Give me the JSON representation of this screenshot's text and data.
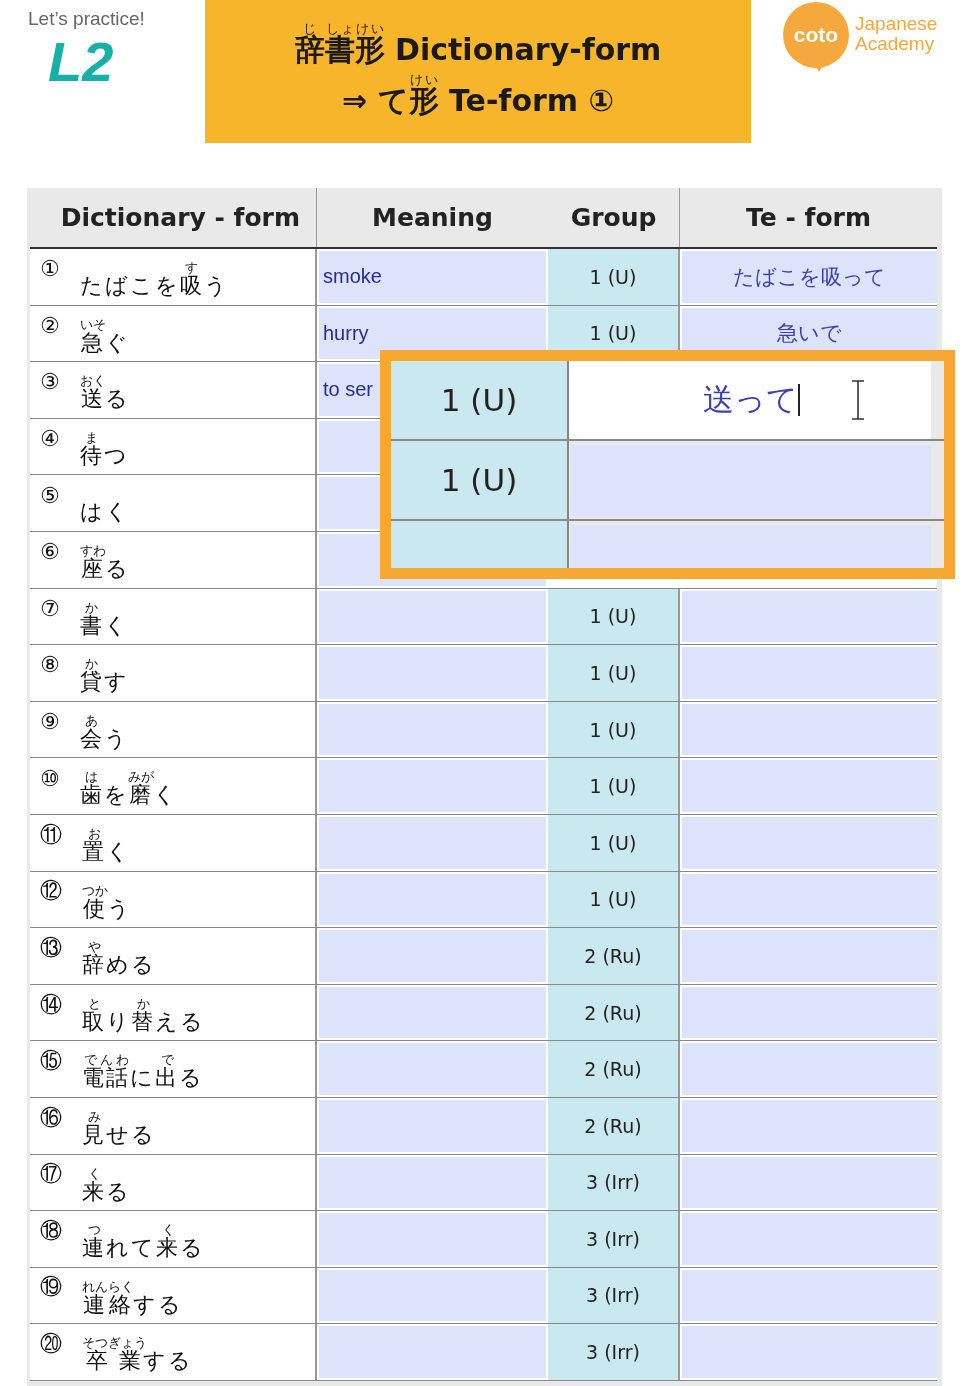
{
  "header": {
    "subtitle": "Let’s practice!",
    "level": "L2",
    "title_lines": [
      [
        {
          "text": "辞",
          "ruby": "じ"
        },
        {
          "text": "書",
          "ruby": "しょ"
        },
        {
          "text": "形",
          "ruby": "けい"
        },
        {
          "text": " Dictionary-form"
        }
      ],
      [
        {
          "text": "⇒ て"
        },
        {
          "text": "形",
          "ruby": "けい"
        },
        {
          "text": " Te-form ①"
        }
      ]
    ],
    "logo": {
      "badge": "coto",
      "name_lines": [
        "Japanese",
        "Academy"
      ]
    }
  },
  "table": {
    "columns": [
      "Dictionary - form",
      "Meaning",
      "Group",
      "Te - form"
    ],
    "rows": [
      {
        "number": "①",
        "word": [
          {
            "text": "たばこを"
          },
          {
            "text": "吸",
            "ruby": "す"
          },
          {
            "text": "う"
          }
        ],
        "meaning": "smoke",
        "group": "1 (U)",
        "te_form": "たばこを吸って"
      },
      {
        "number": "②",
        "word": [
          {
            "text": "急",
            "ruby": "いそ"
          },
          {
            "text": "ぐ"
          }
        ],
        "meaning": "hurry",
        "group": "1 (U)",
        "te_form": "急いで"
      },
      {
        "number": "③",
        "word": [
          {
            "text": "送",
            "ruby": "おく"
          },
          {
            "text": "る"
          }
        ],
        "meaning": "to ser"
      },
      {
        "number": "④",
        "word": [
          {
            "text": "待",
            "ruby": "ま"
          },
          {
            "text": "つ"
          }
        ]
      },
      {
        "number": "⑤",
        "word": [
          {
            "text": "はく"
          }
        ]
      },
      {
        "number": "⑥",
        "word": [
          {
            "text": "座",
            "ruby": "すわ"
          },
          {
            "text": "る"
          }
        ]
      },
      {
        "number": "⑦",
        "word": [
          {
            "text": "書",
            "ruby": "か"
          },
          {
            "text": "く"
          }
        ],
        "group": "1 (U)"
      },
      {
        "number": "⑧",
        "word": [
          {
            "text": "貸",
            "ruby": "か"
          },
          {
            "text": "す"
          }
        ],
        "group": "1 (U)"
      },
      {
        "number": "⑨",
        "word": [
          {
            "text": "会",
            "ruby": "あ"
          },
          {
            "text": "う"
          }
        ],
        "group": "1 (U)"
      },
      {
        "number": "⑩",
        "word": [
          {
            "text": "歯",
            "ruby": "は"
          },
          {
            "text": "を"
          },
          {
            "text": "磨",
            "ruby": "みが"
          },
          {
            "text": "く"
          }
        ],
        "group": "1 (U)"
      },
      {
        "number": "⑪",
        "word": [
          {
            "text": "置",
            "ruby": "お"
          },
          {
            "text": "く"
          }
        ],
        "group": "1 (U)"
      },
      {
        "number": "⑫",
        "word": [
          {
            "text": "使",
            "ruby": "つか"
          },
          {
            "text": "う"
          }
        ],
        "group": "1 (U)"
      },
      {
        "number": "⑬",
        "word": [
          {
            "text": "辞",
            "ruby": "や"
          },
          {
            "text": "める"
          }
        ],
        "group": "2 (Ru)"
      },
      {
        "number": "⑭",
        "word": [
          {
            "text": "取",
            "ruby": "と"
          },
          {
            "text": "り"
          },
          {
            "text": "替",
            "ruby": "か"
          },
          {
            "text": "える"
          }
        ],
        "group": "2 (Ru)"
      },
      {
        "number": "⑮",
        "word": [
          {
            "text": "電話",
            "ruby": "でんわ"
          },
          {
            "text": "に"
          },
          {
            "text": "出",
            "ruby": "で"
          },
          {
            "text": "る"
          }
        ],
        "group": "2 (Ru)"
      },
      {
        "number": "⑯",
        "word": [
          {
            "text": "見",
            "ruby": "み"
          },
          {
            "text": "せる"
          }
        ],
        "group": "2 (Ru)"
      },
      {
        "number": "⑰",
        "word": [
          {
            "text": "来",
            "ruby": "く"
          },
          {
            "text": "る"
          }
        ],
        "group": "3 (Irr)"
      },
      {
        "number": "⑱",
        "word": [
          {
            "text": "連",
            "ruby": "つ"
          },
          {
            "text": "れて"
          },
          {
            "text": "来",
            "ruby": "く"
          },
          {
            "text": "る"
          }
        ],
        "group": "3 (Irr)"
      },
      {
        "number": "⑲",
        "word": [
          {
            "text": "連絡",
            "ruby": "れんらく"
          },
          {
            "text": "する"
          }
        ],
        "group": "3 (Irr)"
      },
      {
        "number": "⑳",
        "word": [
          {
            "text": "卒業",
            "ruby": "そつぎょう"
          },
          {
            "text": "する"
          }
        ],
        "group": "3 (Irr)"
      }
    ]
  },
  "zoom_callout": {
    "rows": [
      {
        "group": "1 (U)",
        "te_form": "送って",
        "editing": true
      },
      {
        "group": "1 (U)",
        "editing": false
      },
      {
        "editing": false
      }
    ]
  }
}
